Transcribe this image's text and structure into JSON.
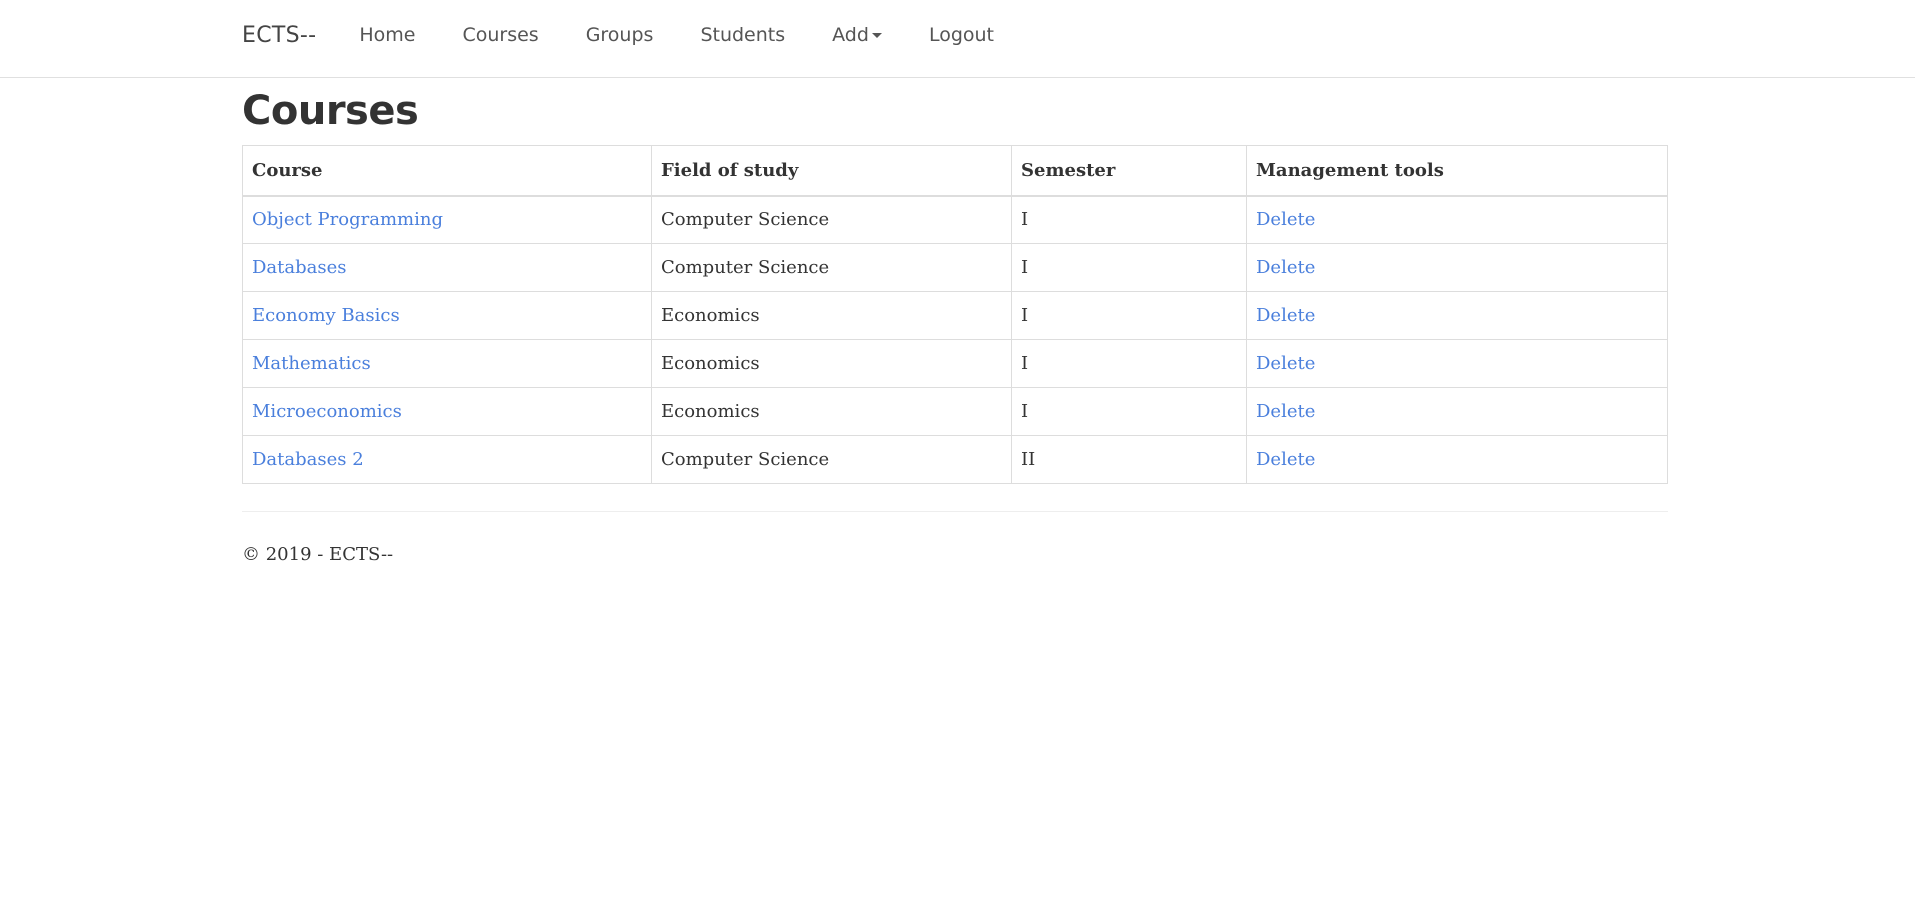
{
  "navbar": {
    "brand": "ECTS--",
    "links": [
      "Home",
      "Courses",
      "Groups",
      "Students"
    ],
    "add_label": "Add",
    "logout_label": "Logout"
  },
  "page": {
    "title": "Courses"
  },
  "table": {
    "headers": [
      "Course",
      "Field of study",
      "Semester",
      "Management tools"
    ],
    "rows": [
      {
        "course": "Object Programming",
        "field": "Computer Science",
        "semester": "I",
        "action": "Delete"
      },
      {
        "course": "Databases",
        "field": "Computer Science",
        "semester": "I",
        "action": "Delete"
      },
      {
        "course": "Economy Basics",
        "field": "Economics",
        "semester": "I",
        "action": "Delete"
      },
      {
        "course": "Mathematics",
        "field": "Economics",
        "semester": "I",
        "action": "Delete"
      },
      {
        "course": "Microeconomics",
        "field": "Economics",
        "semester": "I",
        "action": "Delete"
      },
      {
        "course": "Databases 2",
        "field": "Computer Science",
        "semester": "II",
        "action": "Delete"
      }
    ]
  },
  "footer": {
    "text": "© 2019 - ECTS--"
  },
  "colors": {
    "link": "#4a7fdc",
    "text": "#333333",
    "border": "#dddddd"
  }
}
